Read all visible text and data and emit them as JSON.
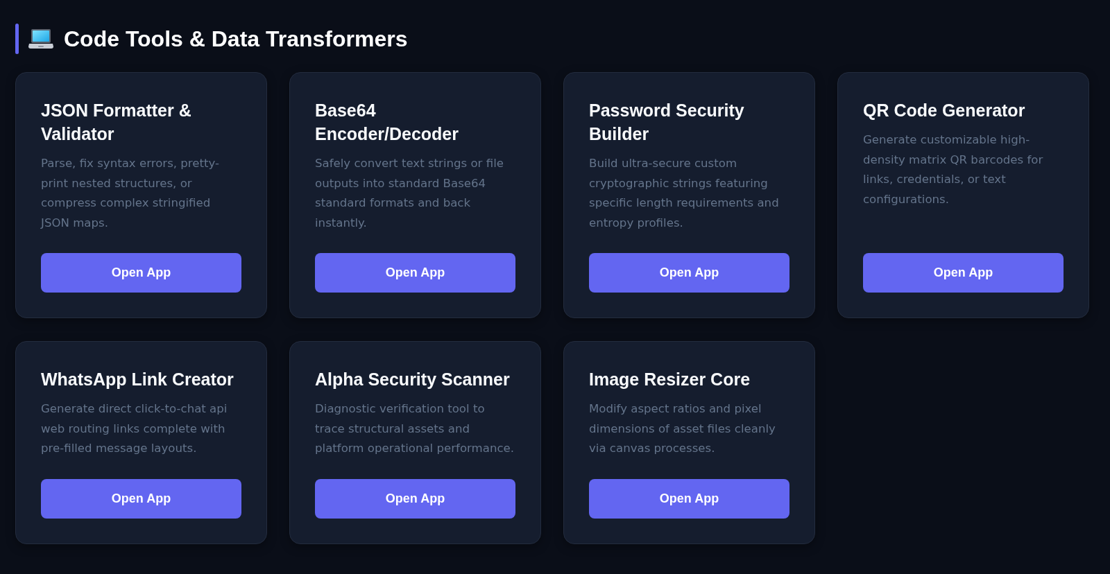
{
  "section": {
    "title": "Code Tools & Data Transformers"
  },
  "tools": [
    {
      "title": "JSON Formatter & Validator",
      "description": "Parse, fix syntax errors, pretty-print nested structures, or compress complex stringified JSON maps.",
      "button": "Open App"
    },
    {
      "title": "Base64 Encoder/Decoder",
      "description": "Safely convert text strings or file outputs into standard Base64 standard formats and back instantly.",
      "button": "Open App"
    },
    {
      "title": "Password Security Builder",
      "description": "Build ultra-secure custom cryptographic strings featuring specific length requirements and entropy profiles.",
      "button": "Open App"
    },
    {
      "title": "QR Code Generator",
      "description": "Generate customizable high-density matrix QR barcodes for links, credentials, or text configurations.",
      "button": "Open App"
    },
    {
      "title": "WhatsApp Link Creator",
      "description": "Generate direct click-to-chat api web routing links complete with pre-filled message layouts.",
      "button": "Open App"
    },
    {
      "title": "Alpha Security Scanner",
      "description": "Diagnostic verification tool to trace structural assets and platform operational performance.",
      "button": "Open App"
    },
    {
      "title": "Image Resizer Core",
      "description": "Modify aspect ratios and pixel dimensions of asset files cleanly via canvas processes.",
      "button": "Open App"
    }
  ]
}
